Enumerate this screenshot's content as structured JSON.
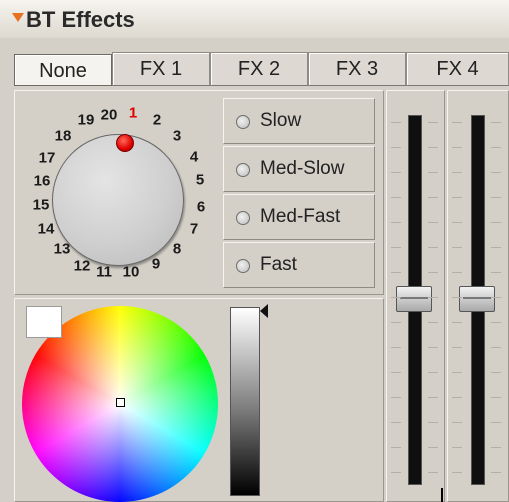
{
  "header": {
    "title": "BT Effects",
    "collapse_icon": "triangle-down-icon"
  },
  "tabs": [
    {
      "label": "None",
      "active": true
    },
    {
      "label": "FX 1",
      "active": false
    },
    {
      "label": "FX 2",
      "active": false
    },
    {
      "label": "FX 3",
      "active": false
    },
    {
      "label": "FX 4",
      "active": false
    }
  ],
  "dial": {
    "numbers": [
      "1",
      "2",
      "3",
      "4",
      "5",
      "6",
      "7",
      "8",
      "9",
      "10",
      "11",
      "12",
      "13",
      "14",
      "15",
      "16",
      "17",
      "18",
      "19",
      "20"
    ],
    "selected": "1",
    "accent_color": "#e00000"
  },
  "speed": {
    "options": [
      "Slow",
      "Med-Slow",
      "Med-Fast",
      "Fast"
    ],
    "selected": null
  },
  "sliders": [
    {
      "name": "slider-1",
      "level_fraction": 0.5
    },
    {
      "name": "slider-2",
      "level_fraction": 0.5
    }
  ],
  "color": {
    "swatch_color": "#ffffff",
    "brightness_fraction": 1.0
  }
}
